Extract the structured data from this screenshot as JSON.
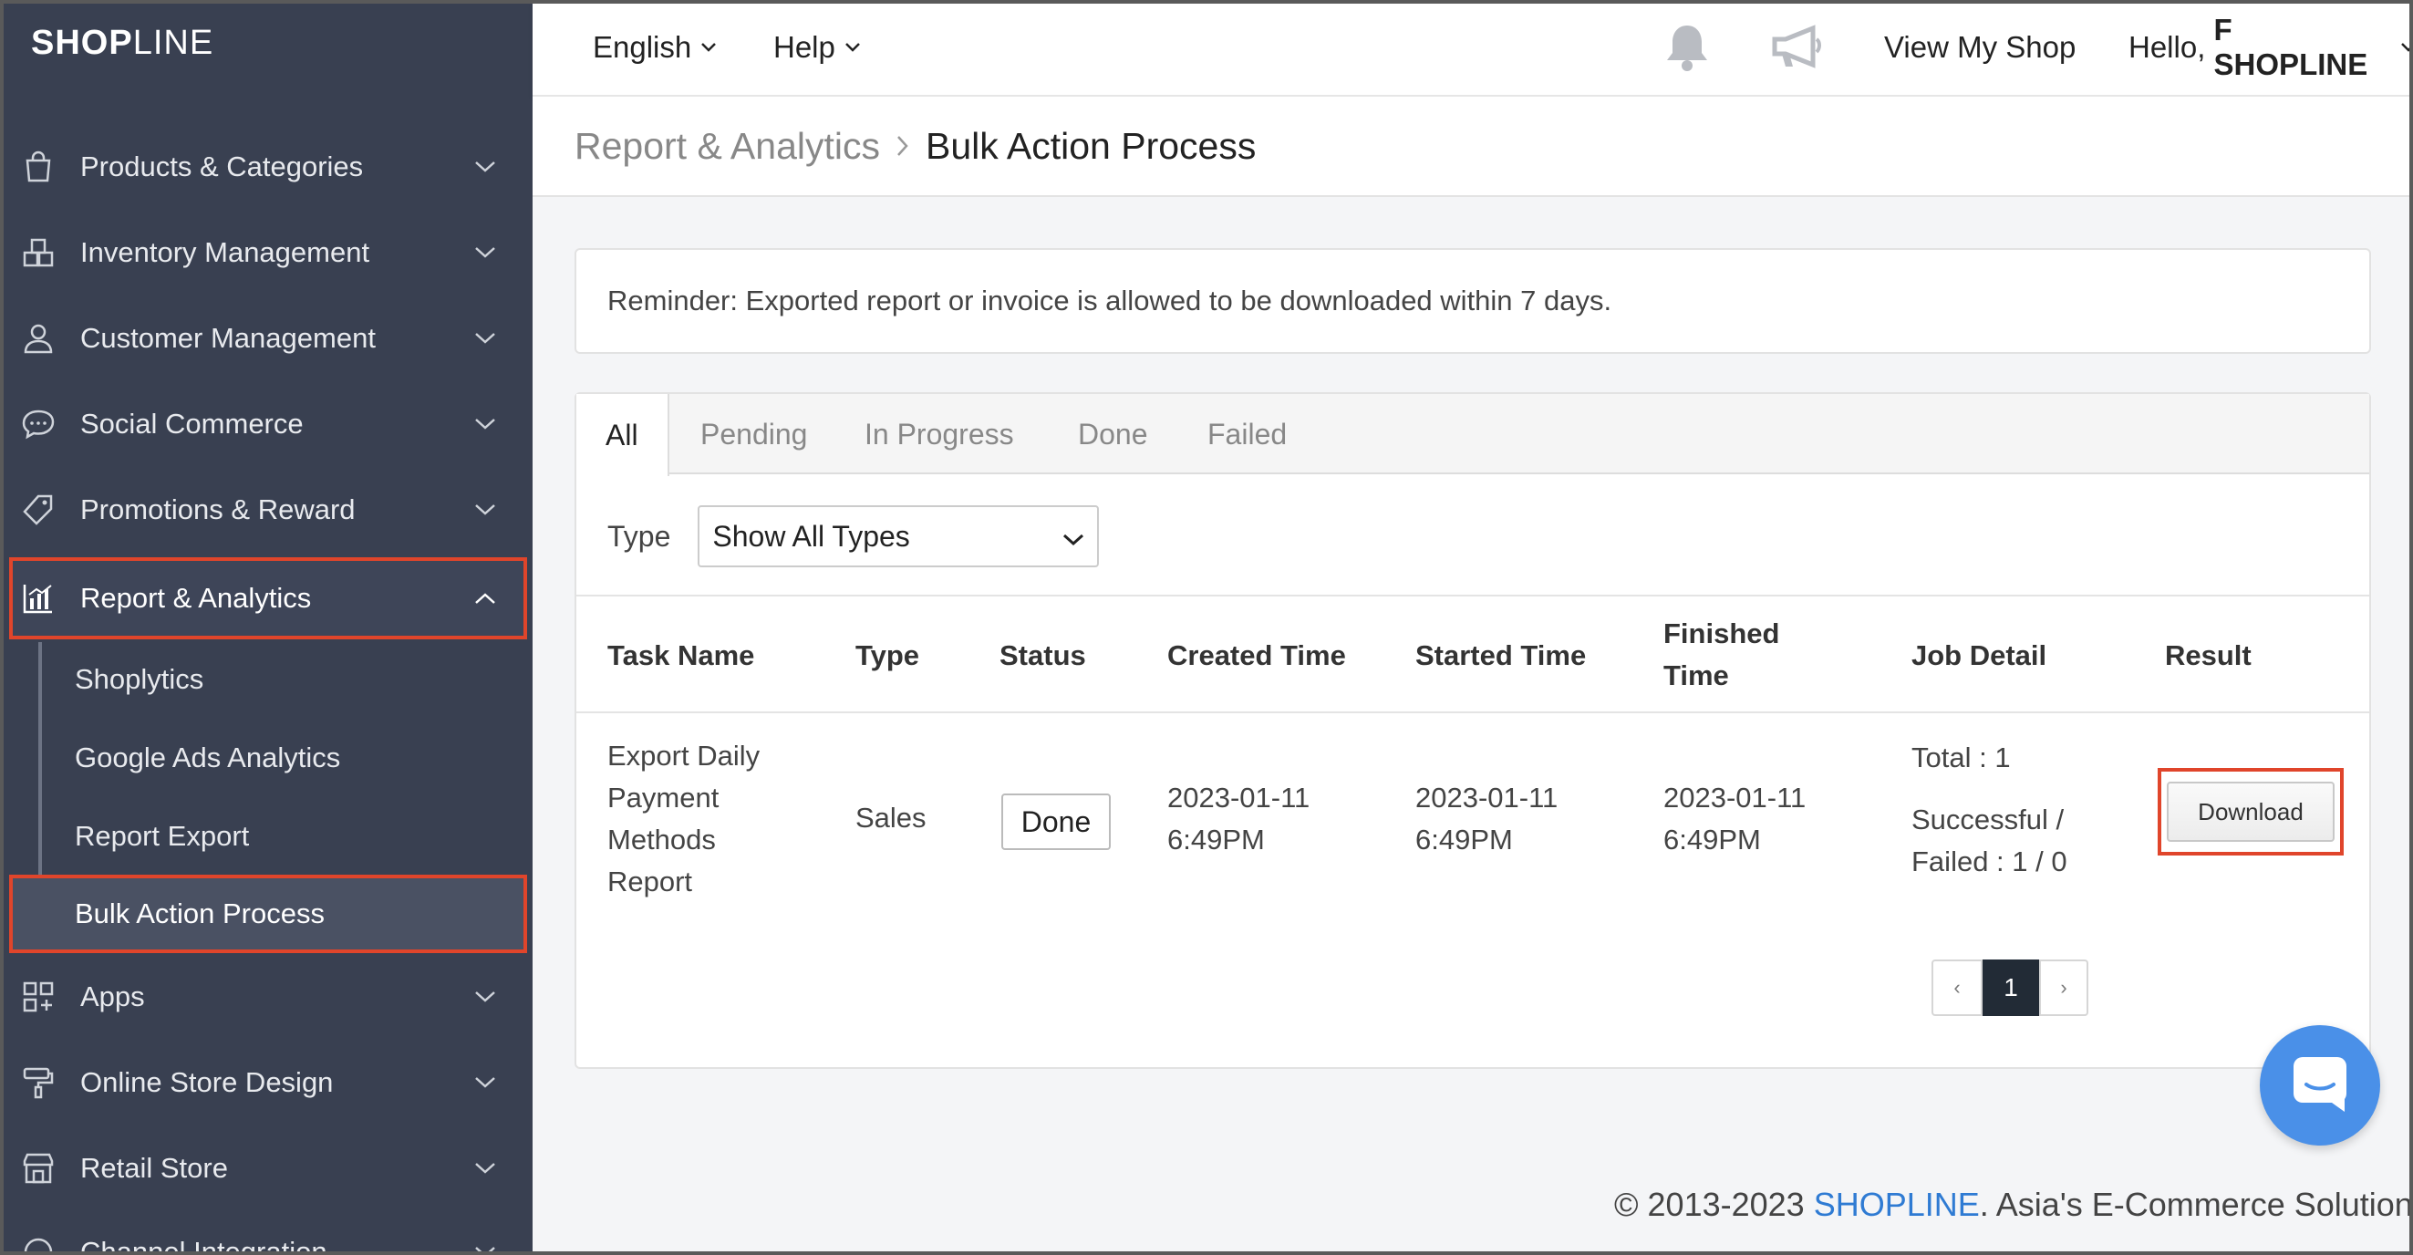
{
  "app": {
    "logo_bold": "SHOP",
    "logo_thin": "LINE"
  },
  "topbar": {
    "language": "English",
    "help": "Help",
    "view_shop": "View My Shop",
    "greeting": "Hello,",
    "user": "F SHOPLINE"
  },
  "sidebar": {
    "items": [
      {
        "label": "Products & Categories",
        "icon": "shopping-bag-icon"
      },
      {
        "label": "Inventory Management",
        "icon": "boxes-icon"
      },
      {
        "label": "Customer Management",
        "icon": "user-icon"
      },
      {
        "label": "Social Commerce",
        "icon": "chat-bubble-icon"
      },
      {
        "label": "Promotions & Reward",
        "icon": "tag-icon"
      },
      {
        "label": "Report & Analytics",
        "icon": "bar-chart-icon"
      },
      {
        "label": "Apps",
        "icon": "apps-grid-icon"
      },
      {
        "label": "Online Store Design",
        "icon": "paint-roller-icon"
      },
      {
        "label": "Retail Store",
        "icon": "store-icon"
      },
      {
        "label": "Channel Integration",
        "icon": "channel-icon"
      }
    ],
    "subitems": [
      {
        "label": "Shoplytics"
      },
      {
        "label": "Google Ads Analytics"
      },
      {
        "label": "Report Export"
      },
      {
        "label": "Bulk Action Process"
      }
    ]
  },
  "breadcrumb": {
    "parent": "Report & Analytics",
    "current": "Bulk Action Process"
  },
  "reminder": "Reminder: Exported report or invoice is allowed to be downloaded within 7 days.",
  "tabs": [
    "All",
    "Pending",
    "In Progress",
    "Done",
    "Failed"
  ],
  "filter": {
    "label": "Type",
    "value": "Show All Types"
  },
  "table": {
    "headers": {
      "task": "Task Name",
      "type": "Type",
      "status": "Status",
      "created": "Created Time",
      "started": "Started Time",
      "finished_1": "Finished",
      "finished_2": "Time",
      "detail": "Job Detail",
      "result": "Result"
    },
    "row": {
      "task_lines": [
        "Export Daily",
        "Payment",
        "Methods",
        "Report"
      ],
      "type": "Sales",
      "status": "Done",
      "created_date": "2023-01-11",
      "created_time": "6:49PM",
      "started_date": "2023-01-11",
      "started_time": "6:49PM",
      "finished_date": "2023-01-11",
      "finished_time": "6:49PM",
      "detail_total": "Total : 1",
      "detail_line2": "Successful /",
      "detail_line3": "Failed : 1 / 0",
      "result_button": "Download"
    }
  },
  "pagination": {
    "prev": "‹",
    "current": "1",
    "next": "›"
  },
  "footer": {
    "prefix": "© 2013-2023 ",
    "brand": "SHOPLINE",
    "suffix": ". Asia's E-Commerce Solution."
  },
  "colors": {
    "sidebar_bg": "#394051",
    "highlight": "#e0452b",
    "brand_link": "#2f7bd3",
    "chat": "#4a90e8"
  }
}
